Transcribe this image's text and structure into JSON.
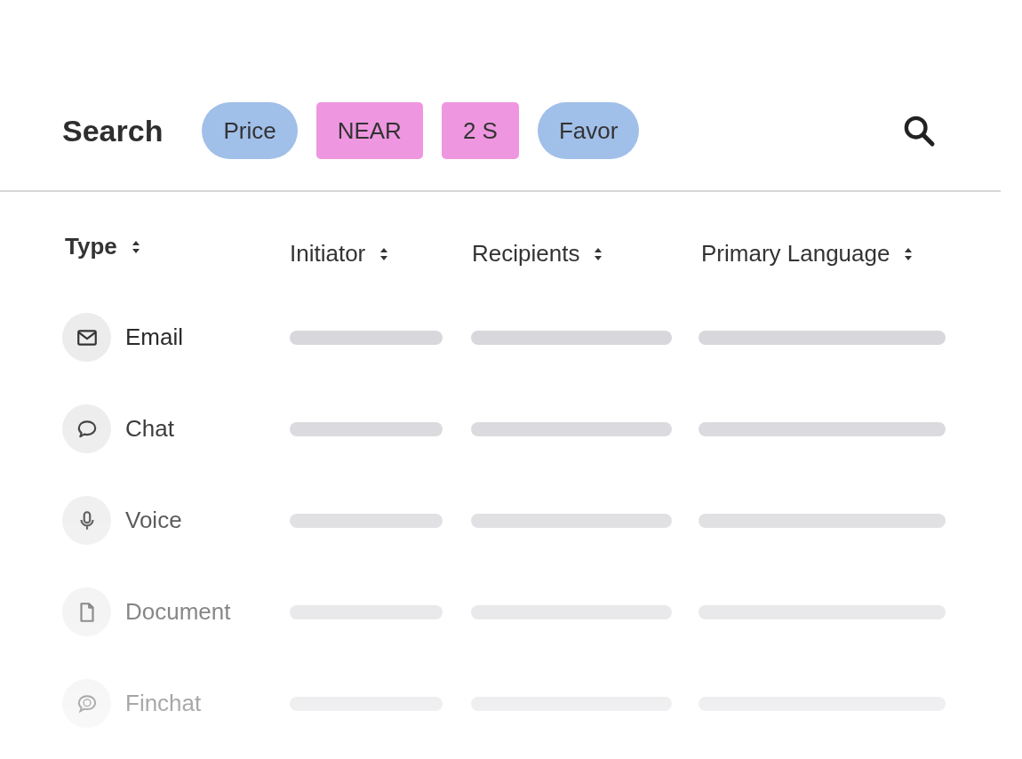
{
  "search": {
    "title": "Search",
    "chips": [
      {
        "label": "Price",
        "kind": "pill",
        "color": "#a0bfe9"
      },
      {
        "label": "NEAR",
        "kind": "tag",
        "color": "#ee97e0"
      },
      {
        "label": "2 S",
        "kind": "tag",
        "color": "#ee97e0"
      },
      {
        "label": "Favor",
        "kind": "pill",
        "color": "#a0bfe9"
      }
    ]
  },
  "table": {
    "columns": [
      "Type",
      "Initiator",
      "Recipients",
      "Primary Language"
    ],
    "rows": [
      {
        "kind": "email",
        "label": "Email"
      },
      {
        "kind": "chat",
        "label": "Chat"
      },
      {
        "kind": "voice",
        "label": "Voice"
      },
      {
        "kind": "document",
        "label": "Document"
      },
      {
        "kind": "finchat",
        "label": "Finchat"
      }
    ]
  }
}
